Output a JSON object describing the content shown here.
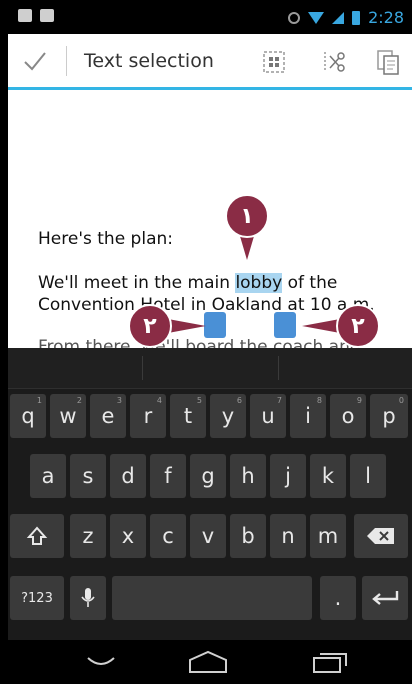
{
  "status_bar": {
    "time": "2:28"
  },
  "action_bar": {
    "title": "Text selection"
  },
  "document": {
    "line1": "Here's the plan:",
    "line2_before": "We'll meet in the main ",
    "line2_selected": "lobby",
    "line2_after": " of the",
    "line3": "Convention Hotel in Oakland at 10 a.m.",
    "line4": "From there, we'll board the coach and"
  },
  "callouts": {
    "one": "١",
    "two_left": "٢",
    "two_right": "٢"
  },
  "keyboard": {
    "row1": [
      {
        "key": "q",
        "hint": "1"
      },
      {
        "key": "w",
        "hint": "2"
      },
      {
        "key": "e",
        "hint": "3"
      },
      {
        "key": "r",
        "hint": "4"
      },
      {
        "key": "t",
        "hint": "5"
      },
      {
        "key": "y",
        "hint": "6"
      },
      {
        "key": "u",
        "hint": "7"
      },
      {
        "key": "i",
        "hint": "8"
      },
      {
        "key": "o",
        "hint": "9"
      },
      {
        "key": "p",
        "hint": "0"
      }
    ],
    "row2": [
      "a",
      "s",
      "d",
      "f",
      "g",
      "h",
      "j",
      "k",
      "l"
    ],
    "row3": [
      "z",
      "x",
      "c",
      "v",
      "b",
      "n",
      "m"
    ],
    "sym_label": "?123",
    "period": "."
  },
  "icons": {
    "check": "check-icon",
    "select_all": "select-all-icon",
    "cut": "cut-icon",
    "copy": "copy-icon",
    "shift": "shift-icon",
    "backspace": "backspace-icon",
    "mic": "mic-icon",
    "enter": "enter-icon",
    "back": "back-icon",
    "home": "home-icon",
    "recents": "recents-icon"
  },
  "colors": {
    "accent": "#33b5e5",
    "callout": "#8a2c45",
    "handle": "#4a90d6",
    "selection": "#a9d5f0"
  }
}
